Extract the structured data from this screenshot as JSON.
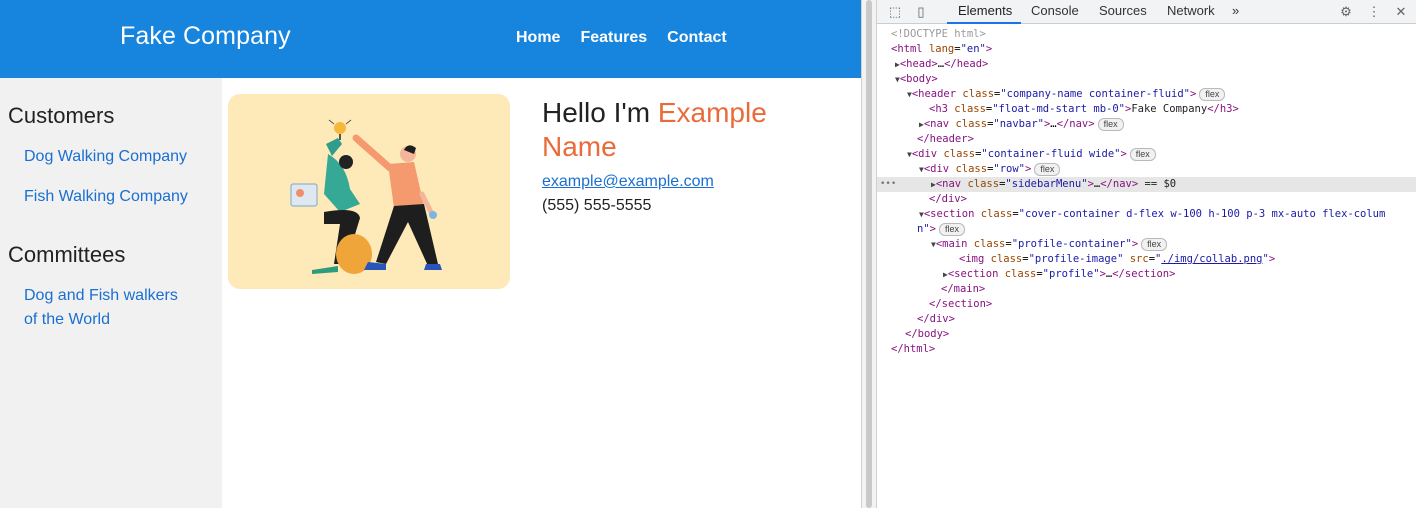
{
  "page": {
    "company_name": "Fake Company",
    "nav": [
      "Home",
      "Features",
      "Contact"
    ],
    "sidebar": {
      "customers_heading": "Customers",
      "customers": [
        "Dog Walking Company",
        "Fish Walking Company"
      ],
      "committees_heading": "Committees",
      "committees": [
        "Dog and Fish walkers",
        "of the World"
      ]
    },
    "profile": {
      "hello_prefix": "Hello I'm ",
      "name": "Example Name",
      "email": "example@example.com",
      "phone": "(555) 555-5555"
    }
  },
  "devtools": {
    "tabs": [
      "Elements",
      "Console",
      "Sources",
      "Network"
    ],
    "more": "»",
    "selected_marker": "== $0",
    "badge": "flex",
    "icons": [
      "inspect-icon",
      "device-icon",
      "gear-icon",
      "more-vert-icon",
      "close-icon"
    ]
  }
}
